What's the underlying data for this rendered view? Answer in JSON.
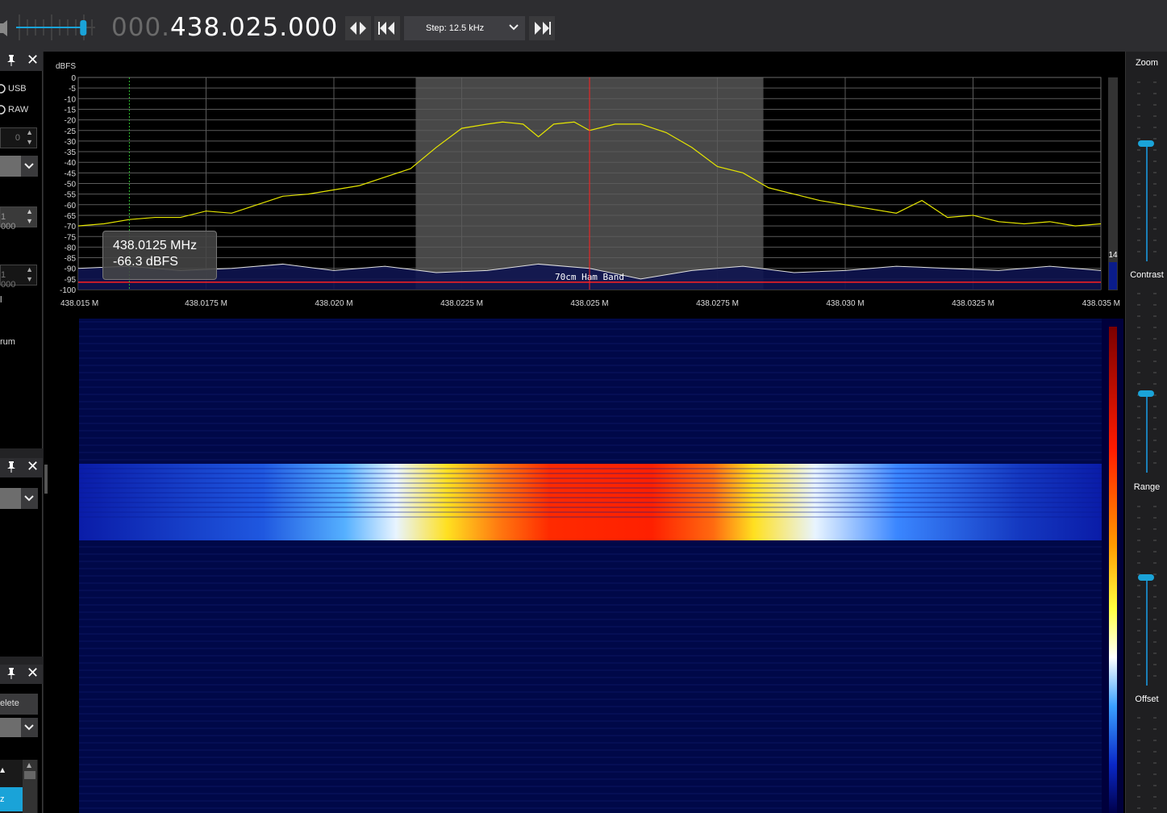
{
  "toolbar": {
    "freq_dim": "000.",
    "freq_main": "438.025.000",
    "step_label": "Step: 12.5 kHz",
    "volume_fraction": 0.85
  },
  "left": {
    "mode_usb": "USB",
    "mode_raw": "RAW",
    "spin_1": "0",
    "spin_2": "1 000",
    "spin_3": "1 000",
    "text_rum": "rum",
    "btn_delete": "elete",
    "selected_item": "z"
  },
  "spectrum": {
    "ylabel": "dBFS",
    "band_label": "70cm Ham Band",
    "peak_badge": "14"
  },
  "tooltip": {
    "line1": "438.0125 MHz",
    "line2": "-66.3 dBFS"
  },
  "right": {
    "zoom": "Zoom",
    "contrast": "Contrast",
    "range": "Range",
    "offset": "Offset"
  },
  "colors": {
    "accent": "#1aa3d8",
    "spectrum_trace": "#e6e600",
    "passband": "#555555",
    "center_line": "#ff2020",
    "band_line": "#ff2020"
  },
  "chart_data": {
    "type": "line",
    "xlabel": "",
    "ylabel": "dBFS",
    "xlim": [
      438.015,
      438.035
    ],
    "ylim": [
      -100,
      0
    ],
    "x_ticks": [
      "438.015 M",
      "438.0175 M",
      "438.020 M",
      "438.0225 M",
      "438.025 M",
      "438.0275 M",
      "438.030 M",
      "438.0325 M",
      "438.035 M"
    ],
    "y_ticks": [
      "0",
      "-5",
      "-10",
      "-15",
      "-20",
      "-25",
      "-30",
      "-35",
      "-40",
      "-45",
      "-50",
      "-55",
      "-60",
      "-65",
      "-70",
      "-75",
      "-80",
      "-85",
      "-90",
      "-95",
      "-100"
    ],
    "center_freq": 438.025,
    "passband": [
      438.0216,
      438.0284
    ],
    "band_marker_dbfs": -95,
    "series": [
      {
        "x": [
          438.015,
          438.0155,
          438.016,
          438.0165,
          438.017,
          438.0175,
          438.018,
          438.0185,
          438.019,
          438.0195,
          438.02,
          438.0205,
          438.021,
          438.0215,
          438.022,
          438.0225,
          438.023,
          438.0233,
          438.0237,
          438.024,
          438.0243,
          438.0247,
          438.025,
          438.0255,
          438.026,
          438.0265,
          438.027,
          438.0275,
          438.028,
          438.0285,
          438.029,
          438.0295,
          438.03,
          438.0305,
          438.031,
          438.0315,
          438.032,
          438.0325,
          438.033,
          438.0335,
          438.034,
          438.0345,
          438.035
        ],
        "values": [
          -70,
          -69,
          -67,
          -66,
          -66,
          -63,
          -64,
          -60,
          -56,
          -55,
          -53,
          -51,
          -47,
          -43,
          -33,
          -24,
          -22,
          -21,
          -22,
          -28,
          -22,
          -21,
          -25,
          -22,
          -22,
          -26,
          -33,
          -42,
          -45,
          -52,
          -55,
          -58,
          -60,
          -62,
          -64,
          -58,
          -66,
          -65,
          -68,
          -69,
          -68,
          -70,
          -69
        ]
      },
      {
        "x": [
          438.015,
          438.016,
          438.017,
          438.018,
          438.019,
          438.02,
          438.021,
          438.022,
          438.023,
          438.024,
          438.025,
          438.026,
          438.027,
          438.028,
          438.029,
          438.03,
          438.031,
          438.032,
          438.033,
          438.034,
          438.035
        ],
        "values": [
          -90,
          -89,
          -91,
          -90,
          -88,
          -91,
          -89,
          -92,
          -91,
          -88,
          -90,
          -95,
          -91,
          -89,
          -92,
          -91,
          -89,
          -90,
          -91,
          -89,
          -91
        ]
      }
    ]
  }
}
